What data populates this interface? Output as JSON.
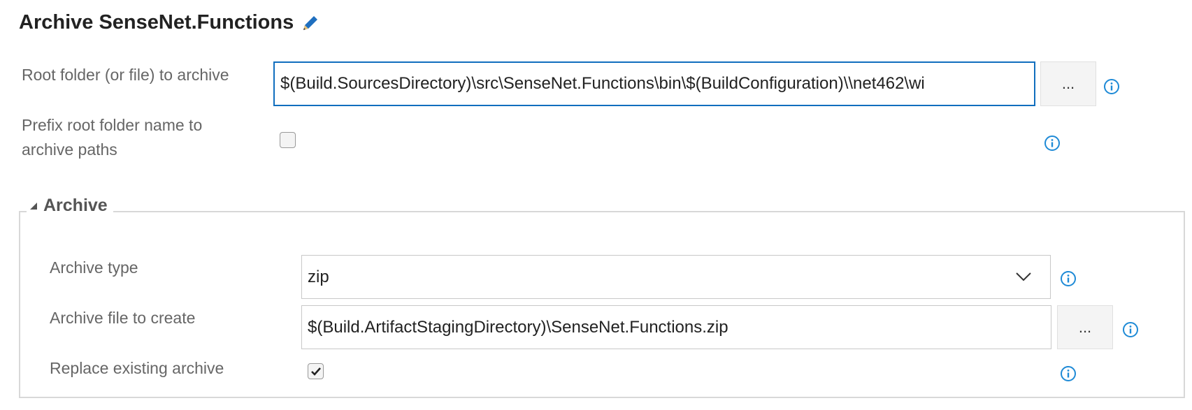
{
  "title": "Archive SenseNet.Functions",
  "root_folder": {
    "label": "Root folder (or file) to archive",
    "value": "$(Build.SourcesDirectory)\\src\\SenseNet.Functions\\bin\\$(BuildConfiguration)\\\\net462\\wi",
    "browse_label": "..."
  },
  "prefix_root": {
    "label_line1": "Prefix root folder name to",
    "label_line2": "archive paths",
    "checked": false
  },
  "archive_section": {
    "legend": "Archive",
    "archive_type": {
      "label": "Archive type",
      "value": "zip"
    },
    "archive_file": {
      "label": "Archive file to create",
      "value": "$(Build.ArtifactStagingDirectory)\\SenseNet.Functions.zip",
      "browse_label": "..."
    },
    "replace_existing": {
      "label": "Replace existing archive",
      "checked": true
    }
  },
  "colors": {
    "focus_border": "#106ebe",
    "info_icon": "#1e8ad6",
    "pencil_icon": "#1f6fbf"
  }
}
